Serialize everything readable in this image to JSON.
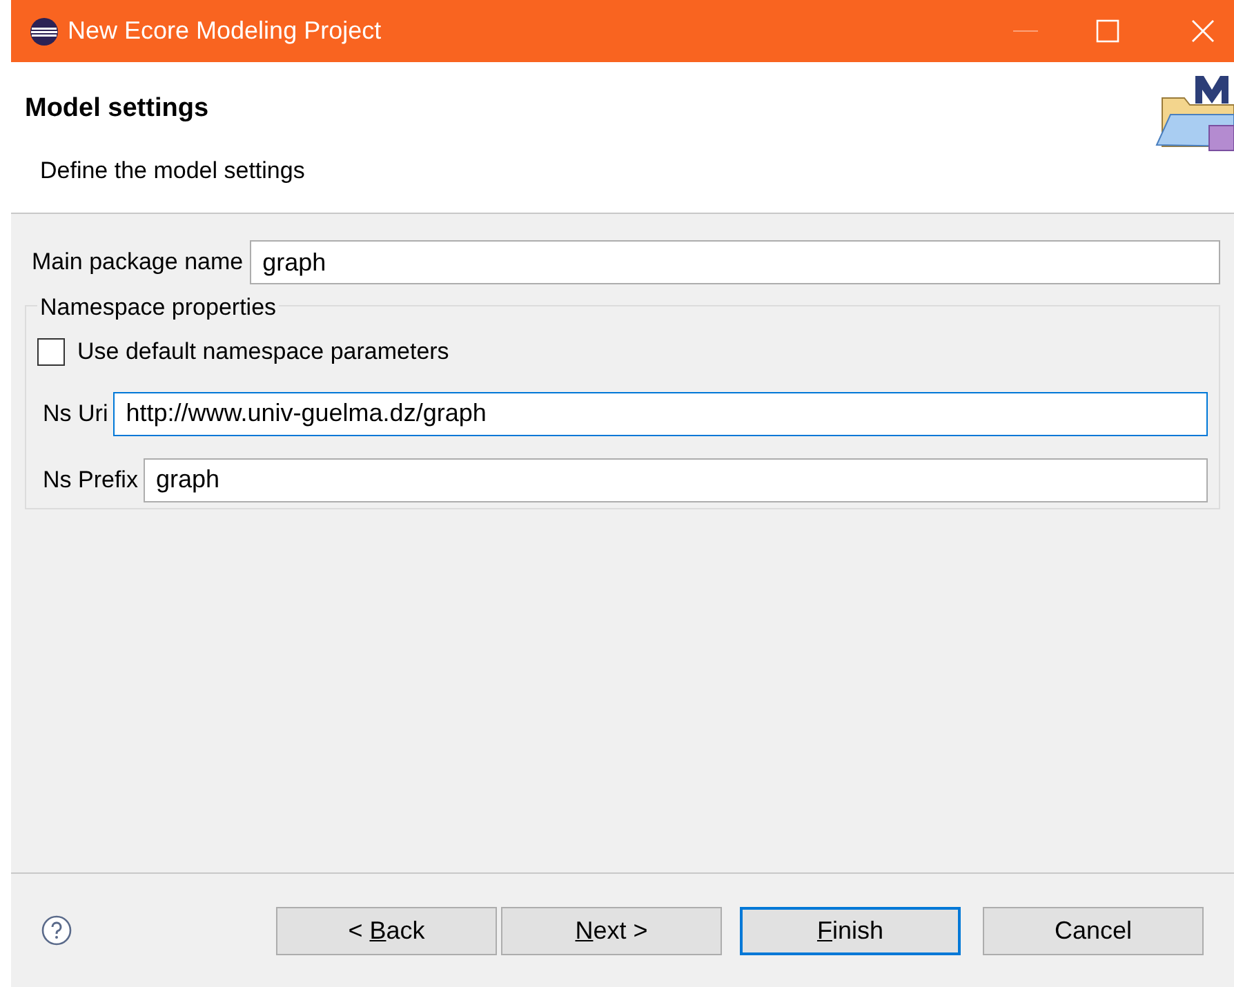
{
  "window": {
    "title": "New Ecore Modeling Project"
  },
  "header": {
    "title": "Model settings",
    "description": "Define the model settings"
  },
  "main_package": {
    "label": "Main package name",
    "value": "graph",
    "focused": false
  },
  "namespace": {
    "title": "Namespace properties",
    "use_default": {
      "label": "Use default namespace parameters",
      "checked": false
    },
    "fields": [
      {
        "label": "Ns Uri",
        "value": "http://www.univ-guelma.dz/graph",
        "focused": true
      },
      {
        "label": "Ns Prefix",
        "value": "graph",
        "focused": false
      }
    ]
  },
  "buttons": [
    {
      "before": "< ",
      "key": "B",
      "after": "ack",
      "default": false
    },
    {
      "key": "N",
      "after": "ext >",
      "default": false
    },
    {
      "key": "F",
      "after": "inish",
      "default": true
    },
    {
      "before": "Cancel",
      "default": false
    }
  ]
}
